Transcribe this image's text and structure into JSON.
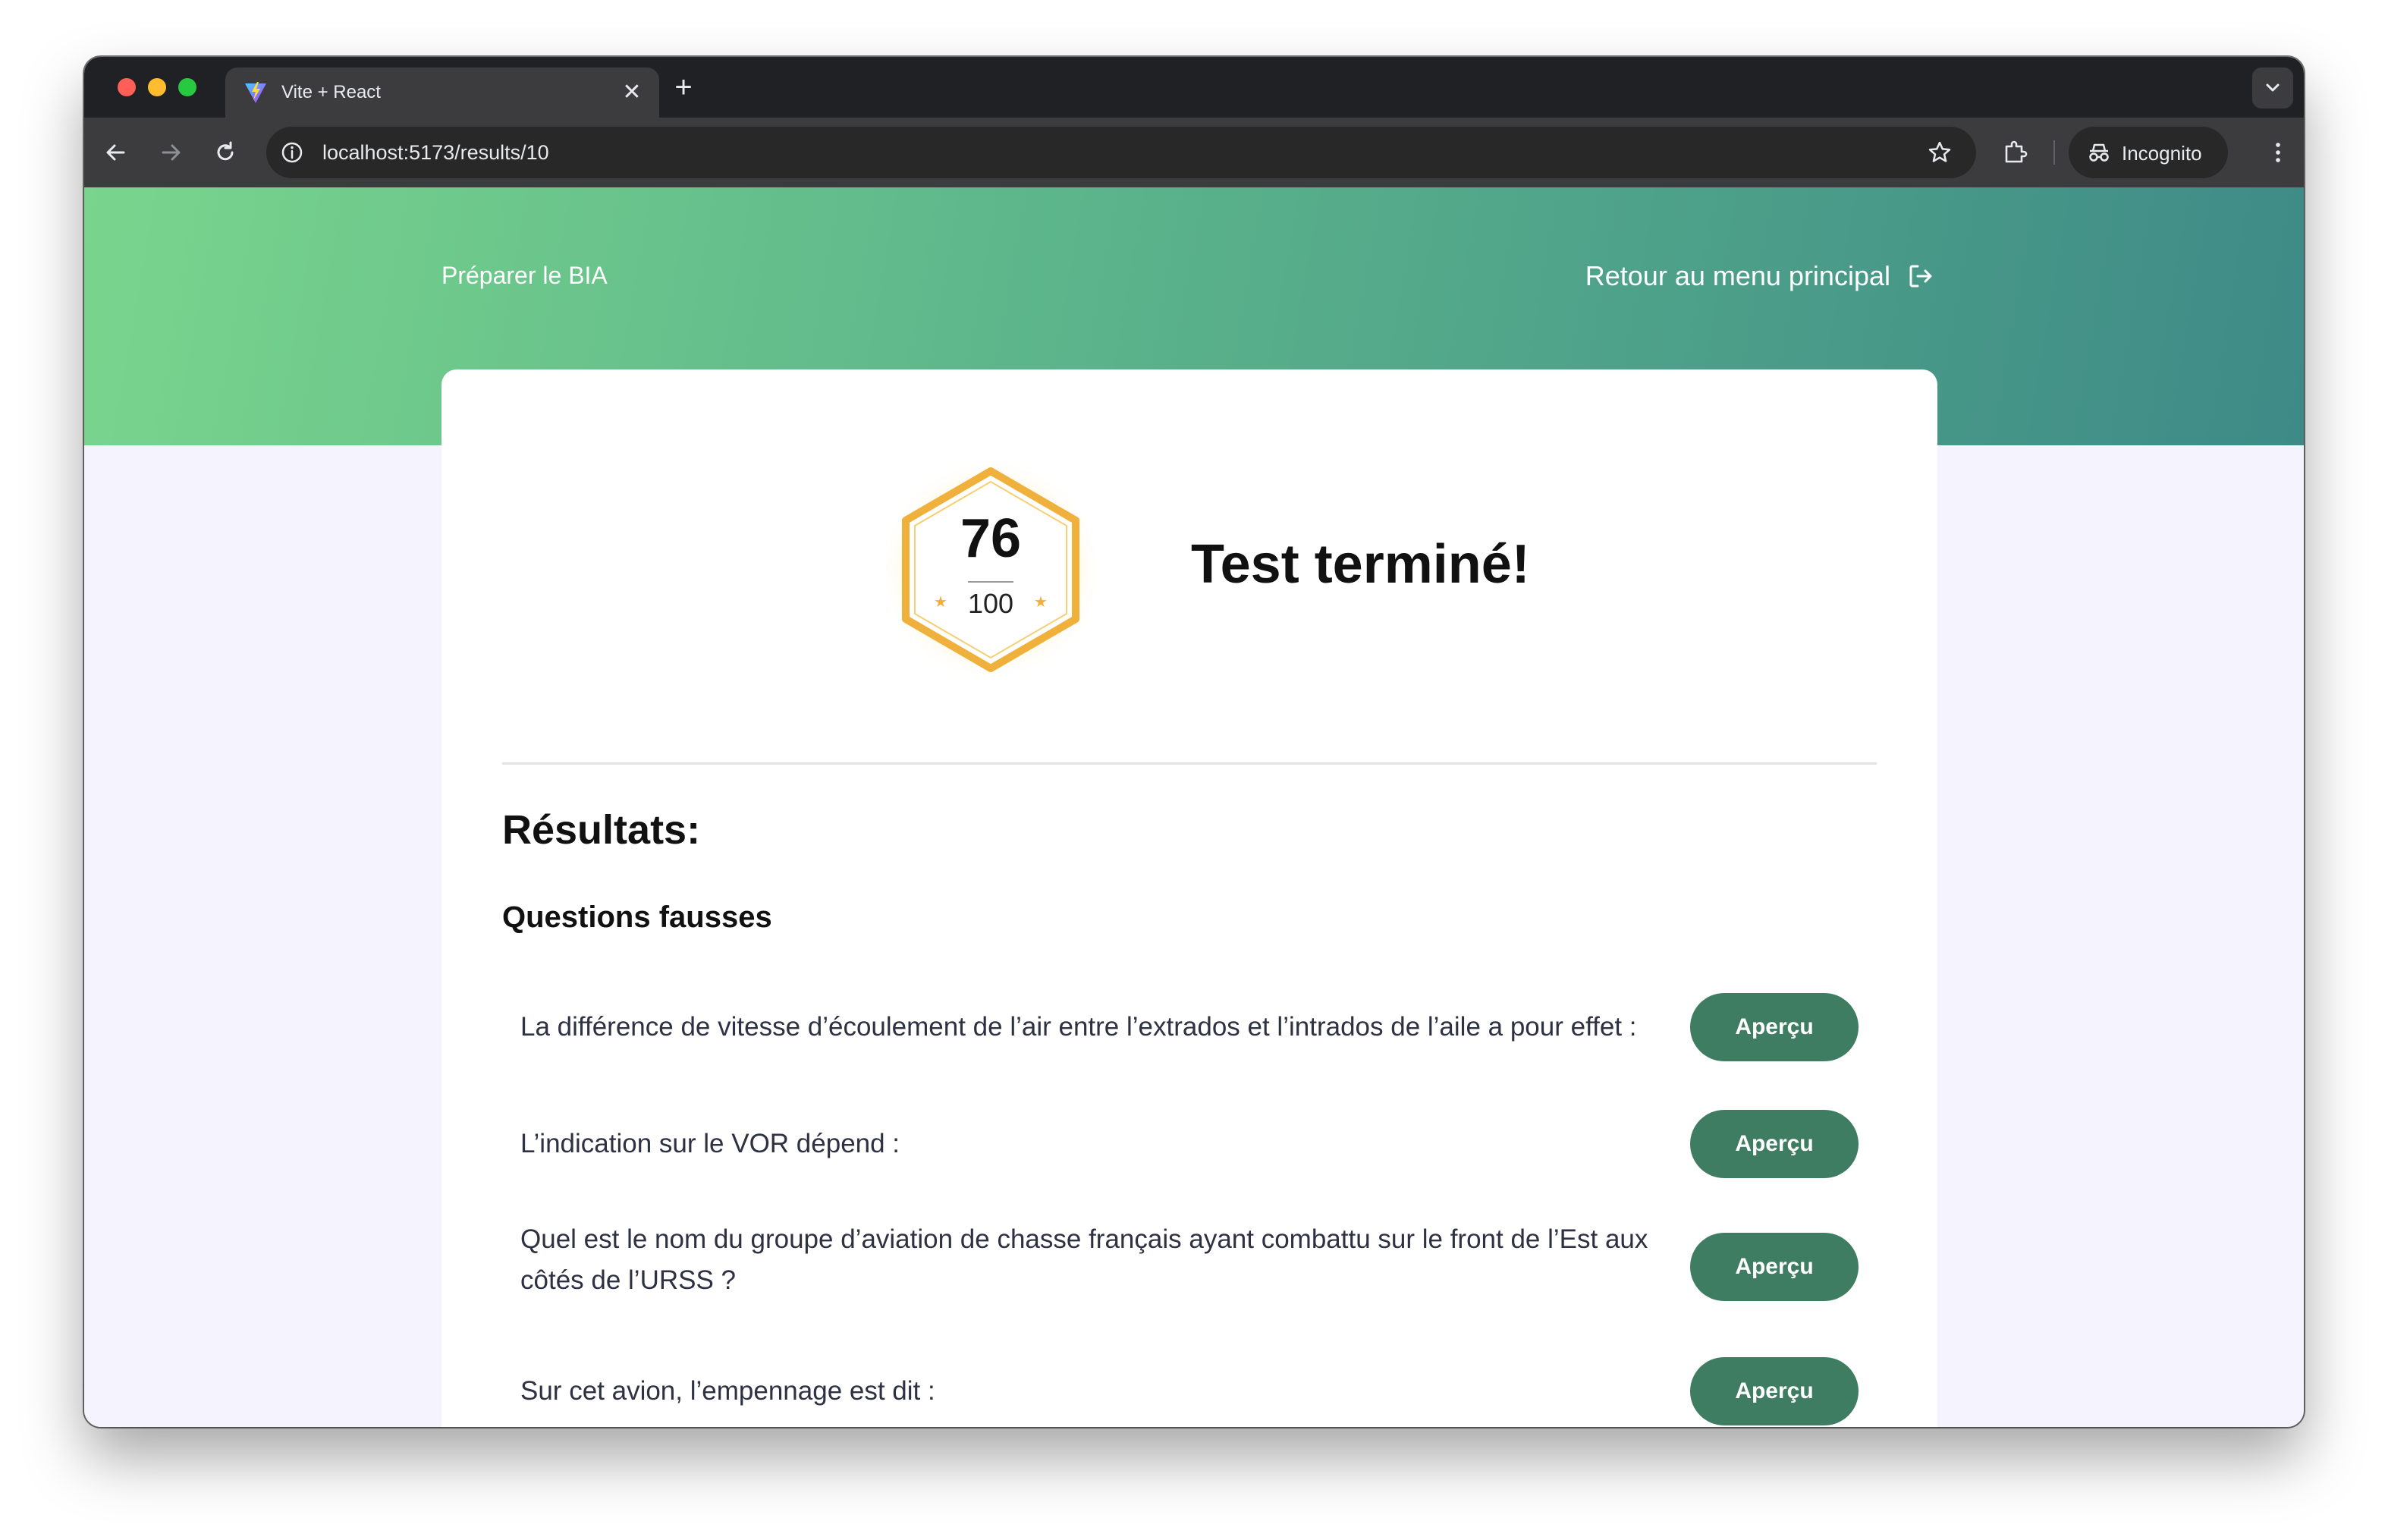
{
  "browser": {
    "tab_title": "Vite + React",
    "tab_close": "✕",
    "new_tab": "+",
    "url": "localhost:5173/results/10",
    "incognito_label": "Incognito"
  },
  "header": {
    "brand": "Préparer le BIA",
    "back_link": "Retour au menu principal"
  },
  "score": {
    "value": "76",
    "max": "100"
  },
  "result_title": "Test terminé!",
  "results": {
    "title": "Résultats:",
    "wrong_title": "Questions fausses",
    "button_label": "Aperçu",
    "questions": [
      {
        "text": "La différence de vitesse d’écoulement de l’air entre l’extrados et l’intrados de l’aile a pour effet :"
      },
      {
        "text": "L’indication sur le VOR dépend :"
      },
      {
        "text": "Quel est le nom du groupe d’aviation de chasse français ayant combattu sur le front de l’Est aux côtés de l’URSS ?"
      },
      {
        "text": "Sur cet avion, l’empennage est dit :"
      }
    ]
  },
  "colors": {
    "hero_start": "#79d58d",
    "hero_end": "#3e8a87",
    "button": "#3f7d62",
    "badge": "#f0b13c",
    "page_bg": "#f4f3fe"
  }
}
